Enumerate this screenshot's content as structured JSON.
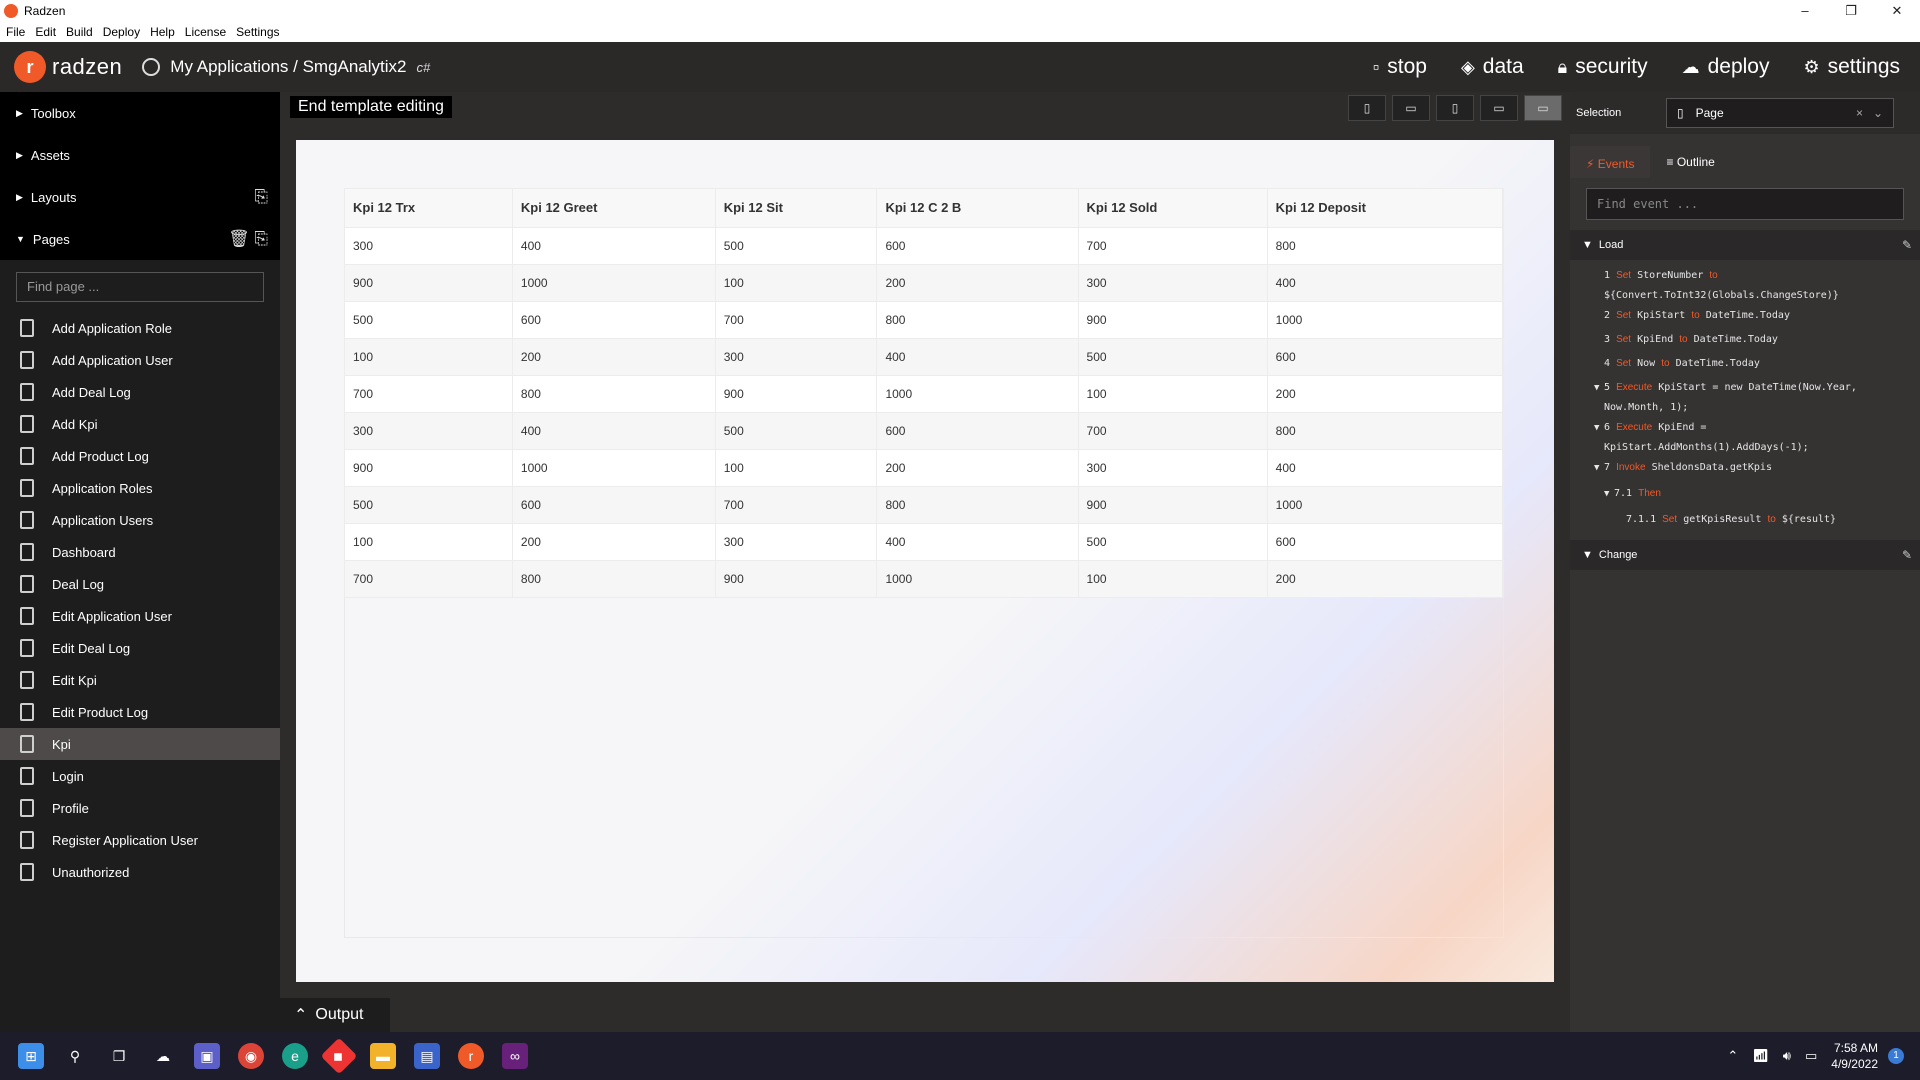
{
  "window": {
    "title": "Radzen",
    "controls": [
      "–",
      "❐",
      "✕"
    ]
  },
  "menu": [
    "File",
    "Edit",
    "Build",
    "Deploy",
    "Help",
    "License",
    "Settings"
  ],
  "header": {
    "logo_text": "radzen",
    "breadcrumb": "My Applications / SmgAnalytix2",
    "lang": "c#",
    "actions": [
      {
        "icon": "stop-icon",
        "label": "stop"
      },
      {
        "icon": "data-icon",
        "label": "data"
      },
      {
        "icon": "lock-icon",
        "label": "security"
      },
      {
        "icon": "cloud-icon",
        "label": "deploy"
      },
      {
        "icon": "gear-icon",
        "label": "settings"
      }
    ]
  },
  "sidebar": {
    "sections": [
      "Toolbox",
      "Assets",
      "Layouts",
      "Pages"
    ],
    "find_placeholder": "Find page ...",
    "pages": [
      "Add Application Role",
      "Add Application User",
      "Add Deal Log",
      "Add Kpi",
      "Add Product Log",
      "Application Roles",
      "Application Users",
      "Dashboard",
      "Deal Log",
      "Edit Application User",
      "Edit Deal Log",
      "Edit Kpi",
      "Edit Product Log",
      "Kpi",
      "Login",
      "Profile",
      "Register Application User",
      "Unauthorized"
    ],
    "active_page": "Kpi"
  },
  "canvas": {
    "end_template": "End template editing",
    "output_label": "Output",
    "columns": [
      "Kpi 12 Trx",
      "Kpi 12 Greet",
      "Kpi 12 Sit",
      "Kpi 12 C 2 B",
      "Kpi 12 Sold",
      "Kpi 12 Deposit"
    ],
    "rows": [
      [
        "300",
        "400",
        "500",
        "600",
        "700",
        "800"
      ],
      [
        "900",
        "1000",
        "100",
        "200",
        "300",
        "400"
      ],
      [
        "500",
        "600",
        "700",
        "800",
        "900",
        "1000"
      ],
      [
        "100",
        "200",
        "300",
        "400",
        "500",
        "600"
      ],
      [
        "700",
        "800",
        "900",
        "1000",
        "100",
        "200"
      ],
      [
        "300",
        "400",
        "500",
        "600",
        "700",
        "800"
      ],
      [
        "900",
        "1000",
        "100",
        "200",
        "300",
        "400"
      ],
      [
        "500",
        "600",
        "700",
        "800",
        "900",
        "1000"
      ],
      [
        "100",
        "200",
        "300",
        "400",
        "500",
        "600"
      ],
      [
        "700",
        "800",
        "900",
        "1000",
        "100",
        "200"
      ]
    ]
  },
  "right_panel": {
    "selection_label": "Selection",
    "selection_value": "Page",
    "tabs": [
      "Events",
      "Outline"
    ],
    "find_event_placeholder": "Find event ...",
    "load_group": "Load",
    "change_group": "Change",
    "events": {
      "e1_num": "1",
      "e1_kw": "Set",
      "e1_target": "StoreNumber",
      "e1_to": "to",
      "e1_value": "${Convert.ToInt32(Globals.ChangeStore)}",
      "e2_num": "2",
      "e2_kw": "Set",
      "e2_target": "KpiStart",
      "e2_to": "to",
      "e2_value": "DateTime.Today",
      "e3_num": "3",
      "e3_kw": "Set",
      "e3_target": "KpiEnd",
      "e3_to": "to",
      "e3_value": "DateTime.Today",
      "e4_num": "4",
      "e4_kw": "Set",
      "e4_target": "Now",
      "e4_to": "to",
      "e4_value": "DateTime.Today",
      "e5_num": "5",
      "e5_kw": "Execute",
      "e5_code": "KpiStart = new DateTime(Now.Year,",
      "e5_cont": "Now.Month, 1);",
      "e6_num": "6",
      "e6_kw": "Execute",
      "e6_code": "KpiEnd =",
      "e6_cont": "KpiStart.AddMonths(1).AddDays(-1);",
      "e7_num": "7",
      "e7_kw": "Invoke",
      "e7_target": "SheldonsData.getKpis",
      "e71_num": "7.1",
      "e71_kw": "Then",
      "e711_num": "7.1.1",
      "e711_kw": "Set",
      "e711_target": "getKpisResult",
      "e711_to": "to",
      "e711_value": "${result}"
    }
  },
  "taskbar": {
    "time": "7:58 AM",
    "date": "4/9/2022",
    "notifications": "1"
  }
}
